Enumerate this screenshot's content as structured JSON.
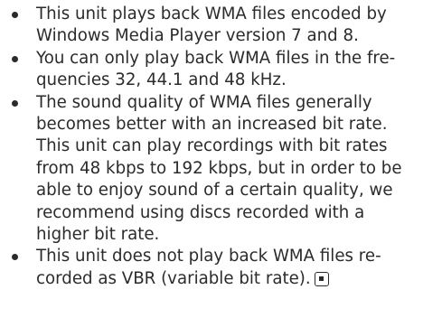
{
  "items": [
    {
      "lines": [
        "This unit plays back WMA files encoded by",
        "Windows Media Player version 7 and 8."
      ]
    },
    {
      "lines": [
        "You can only play back WMA files in the fre-",
        "quencies 32, 44.1 and 48 kHz."
      ]
    },
    {
      "lines": [
        "The sound quality of WMA files generally",
        "becomes better with an increased bit rate.",
        "This unit can play recordings with bit rates",
        "from 48 kbps to 192 kbps, but in order to be",
        "able to enjoy sound of a certain quality, we",
        "recommend using discs recorded with a",
        "higher bit rate."
      ]
    },
    {
      "lines": [
        "This unit does not play back WMA files re-",
        "corded as VBR (variable bit rate)."
      ]
    }
  ],
  "end_icon": "end-of-section-icon"
}
